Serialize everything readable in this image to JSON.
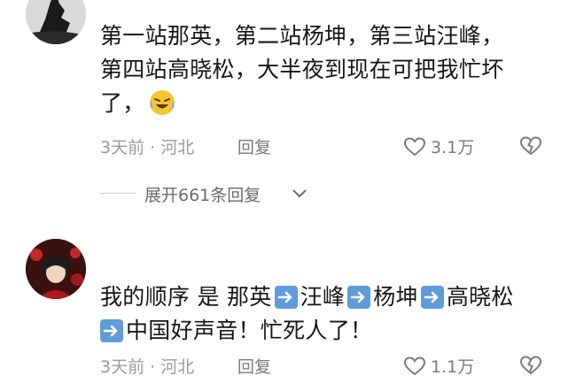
{
  "comments": [
    {
      "lines": [
        "第一站那英，第二站杨坤，第三站汪峰，",
        "第四站高晓松，大半夜到现在可把我忙坏",
        "了，"
      ],
      "emoji": "laughing-tears-emoji",
      "time": "3天前",
      "separator": "·",
      "location": "河北",
      "reply_label": "回复",
      "likes": "3.1万",
      "expand_label": "展开661条回复"
    },
    {
      "line1_parts": [
        "我的顺序 是 那英",
        "汪峰",
        "杨坤",
        "高晓松"
      ],
      "line2_parts": [
        "中国好声音！忙死人了！"
      ],
      "arrow_icon": "right-arrow-emoji",
      "time": "3天前",
      "separator": "·",
      "location": "河北",
      "reply_label": "回复",
      "likes": "1.1万"
    }
  ],
  "colors": {
    "arrow_emoji": "#5f9cd9",
    "meta_text": "#9a9a9a",
    "action_text": "#7a7a7a"
  }
}
